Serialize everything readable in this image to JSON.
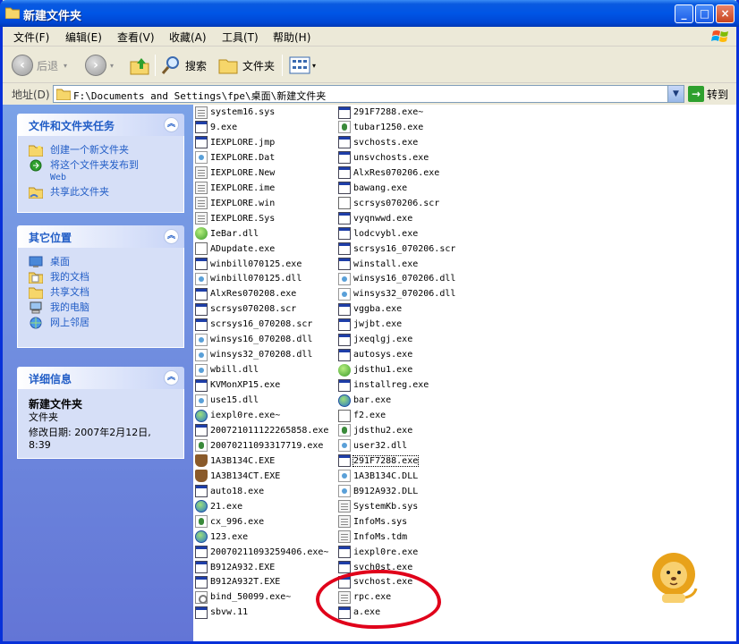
{
  "window": {
    "title": "新建文件夹",
    "controls": {
      "minimize": "_",
      "maximize": "□",
      "close": "×"
    }
  },
  "menu": [
    "文件(F)",
    "编辑(E)",
    "查看(V)",
    "收藏(A)",
    "工具(T)",
    "帮助(H)"
  ],
  "toolbar": {
    "back": "后退",
    "search": "搜索",
    "folders": "文件夹"
  },
  "address": {
    "label": "地址(D)",
    "path": "F:\\Documents and Settings\\fpe\\桌面\\新建文件夹",
    "go": "转到"
  },
  "sidebar": {
    "tasks": {
      "title": "文件和文件夹任务",
      "items": [
        "创建一个新文件夹",
        "将这个文件夹发布到",
        "Web",
        "共享此文件夹"
      ]
    },
    "places": {
      "title": "其它位置",
      "items": [
        "桌面",
        "我的文档",
        "共享文档",
        "我的电脑",
        "网上邻居"
      ]
    },
    "details": {
      "title": "详细信息",
      "name": "新建文件夹",
      "type": "文件夹",
      "modified": "修改日期: 2007年2月12日,",
      "time": "8:39"
    }
  },
  "files": {
    "col1": [
      {
        "name": "system16.sys",
        "icon": "doc"
      },
      {
        "name": "9.exe",
        "icon": "exe"
      },
      {
        "name": "IEXPLORE.jmp",
        "icon": "exe"
      },
      {
        "name": "IEXPLORE.Dat",
        "icon": "dll"
      },
      {
        "name": "IEXPLORE.New",
        "icon": "doc"
      },
      {
        "name": "IEXPLORE.ime",
        "icon": "doc"
      },
      {
        "name": "IEXPLORE.win",
        "icon": "doc"
      },
      {
        "name": "IEXPLORE.Sys",
        "icon": "doc"
      },
      {
        "name": "IeBar.dll",
        "icon": "green"
      },
      {
        "name": "ADupdate.exe",
        "icon": "plain"
      },
      {
        "name": "winbill070125.exe",
        "icon": "exe"
      },
      {
        "name": "winbill070125.dll",
        "icon": "dll"
      },
      {
        "name": "AlxRes070208.exe",
        "icon": "exe"
      },
      {
        "name": "scrsys070208.scr",
        "icon": "exe"
      },
      {
        "name": "scrsys16_070208.scr",
        "icon": "exe"
      },
      {
        "name": "winsys16_070208.dll",
        "icon": "dll"
      },
      {
        "name": "winsys32_070208.dll",
        "icon": "dll"
      },
      {
        "name": "wbill.dll",
        "icon": "dll"
      },
      {
        "name": "KVMonXP15.exe",
        "icon": "exe"
      },
      {
        "name": "use15.dll",
        "icon": "dll"
      },
      {
        "name": "iexpl0re.exe~",
        "icon": "world"
      },
      {
        "name": "200721011122265858.exe",
        "icon": "exe"
      },
      {
        "name": "20070211093317719.exe",
        "icon": "people"
      },
      {
        "name": "1A3B134C.EXE",
        "icon": "brown"
      },
      {
        "name": "1A3B134CT.EXE",
        "icon": "brown"
      },
      {
        "name": "auto18.exe",
        "icon": "exe"
      },
      {
        "name": "21.exe",
        "icon": "world"
      },
      {
        "name": "cx_996.exe",
        "icon": "people"
      },
      {
        "name": "123.exe",
        "icon": "world"
      },
      {
        "name": "20070211093259406.exe~",
        "icon": "exe"
      },
      {
        "name": "B912A932.EXE",
        "icon": "exe"
      },
      {
        "name": "B912A932T.EXE",
        "icon": "exe"
      },
      {
        "name": "bind_50099.exe~",
        "icon": "gear"
      },
      {
        "name": "sbvw.11",
        "icon": "exe"
      }
    ],
    "col2": [
      {
        "name": "291F7288.exe~",
        "icon": "exe"
      },
      {
        "name": "tubar1250.exe",
        "icon": "people"
      },
      {
        "name": "svchosts.exe",
        "icon": "exe"
      },
      {
        "name": "unsvchosts.exe",
        "icon": "exe"
      },
      {
        "name": "AlxRes070206.exe",
        "icon": "exe"
      },
      {
        "name": "bawang.exe",
        "icon": "exe"
      },
      {
        "name": "scrsys070206.scr",
        "icon": "plain"
      },
      {
        "name": "vyqnwwd.exe",
        "icon": "exe"
      },
      {
        "name": "lodcvybl.exe",
        "icon": "exe"
      },
      {
        "name": "scrsys16_070206.scr",
        "icon": "exe"
      },
      {
        "name": "winstall.exe",
        "icon": "exe"
      },
      {
        "name": "winsys16_070206.dll",
        "icon": "dll"
      },
      {
        "name": "winsys32_070206.dll",
        "icon": "dll"
      },
      {
        "name": "vggba.exe",
        "icon": "exe"
      },
      {
        "name": "jwjbt.exe",
        "icon": "exe"
      },
      {
        "name": "jxeqlgj.exe",
        "icon": "exe"
      },
      {
        "name": "autosys.exe",
        "icon": "exe"
      },
      {
        "name": "jdsthu1.exe",
        "icon": "green"
      },
      {
        "name": "installreg.exe",
        "icon": "exe"
      },
      {
        "name": "bar.exe",
        "icon": "world"
      },
      {
        "name": "f2.exe",
        "icon": "plain"
      },
      {
        "name": "jdsthu2.exe",
        "icon": "people"
      },
      {
        "name": "user32.dll",
        "icon": "dll"
      },
      {
        "name": "291F7288.exe",
        "icon": "exe"
      },
      {
        "name": "1A3B134C.DLL",
        "icon": "dll"
      },
      {
        "name": "B912A932.DLL",
        "icon": "dll"
      },
      {
        "name": "SystemKb.sys",
        "icon": "doc"
      },
      {
        "name": "InfoMs.sys",
        "icon": "doc"
      },
      {
        "name": "InfoMs.tdm",
        "icon": "doc"
      },
      {
        "name": "iexpl0re.exe",
        "icon": "exe"
      },
      {
        "name": "svch0st.exe",
        "icon": "exe"
      },
      {
        "name": "svchost.exe",
        "icon": "exe"
      },
      {
        "name": "rpc.exe",
        "icon": "doc"
      },
      {
        "name": "a.exe",
        "icon": "exe"
      }
    ]
  },
  "colors": {
    "accent": "#215dc6",
    "annotation": "#e0001a"
  }
}
